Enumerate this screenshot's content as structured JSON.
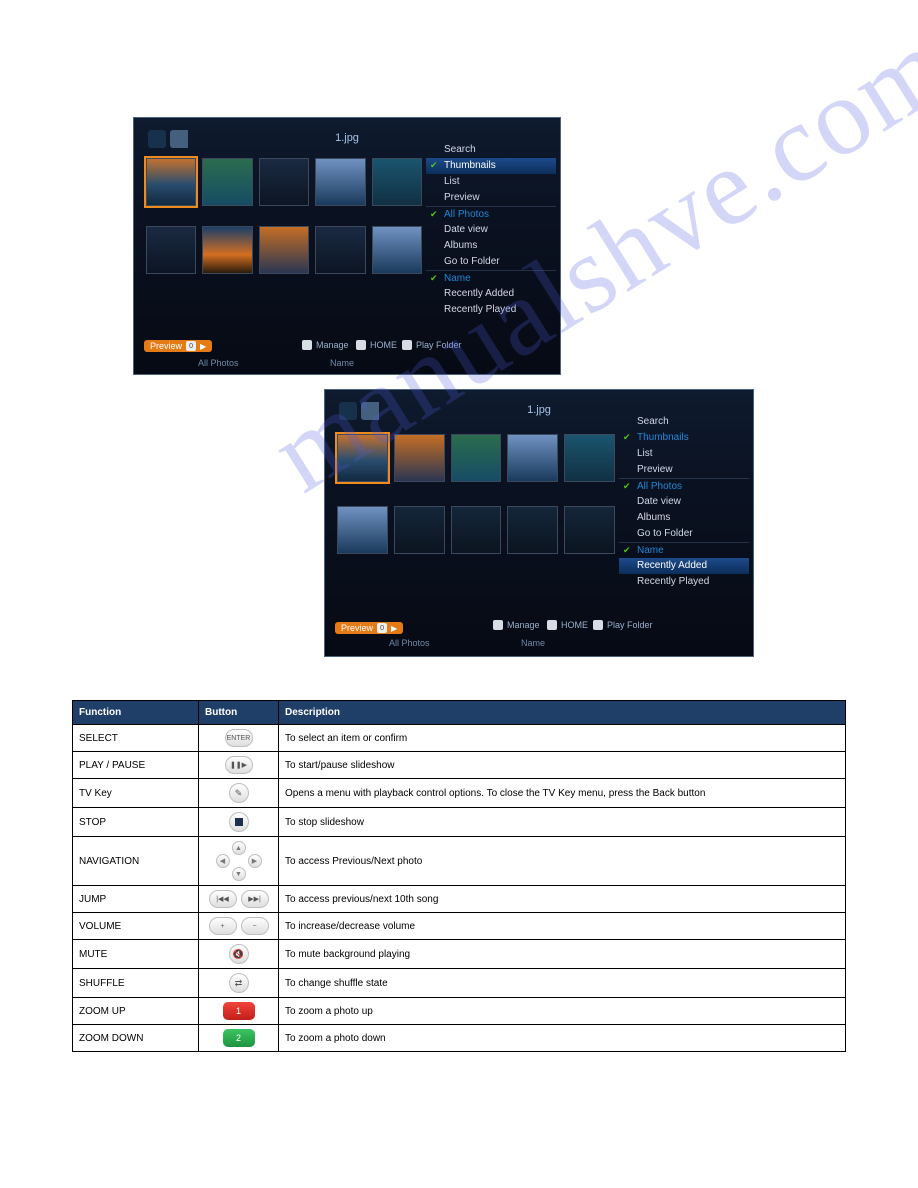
{
  "watermark_text": "manualshve.com",
  "screenshot1": {
    "title": "1.jpg",
    "menu_items": [
      {
        "label": "Search",
        "checked": false,
        "highlight": false,
        "active": false,
        "sep": false
      },
      {
        "label": "Thumbnails",
        "checked": true,
        "highlight": true,
        "active": false,
        "sep": false
      },
      {
        "label": "List",
        "checked": false,
        "highlight": false,
        "active": false,
        "sep": false
      },
      {
        "label": "Preview",
        "checked": false,
        "highlight": false,
        "active": false,
        "sep": false
      },
      {
        "label": "All Photos",
        "checked": true,
        "highlight": false,
        "active": true,
        "sep": true
      },
      {
        "label": "Date view",
        "checked": false,
        "highlight": false,
        "active": false,
        "sep": false
      },
      {
        "label": "Albums",
        "checked": false,
        "highlight": false,
        "active": false,
        "sep": false
      },
      {
        "label": "Go to Folder",
        "checked": false,
        "highlight": false,
        "active": false,
        "sep": false
      },
      {
        "label": "Name",
        "checked": true,
        "highlight": false,
        "active": true,
        "sep": true
      },
      {
        "label": "Recently Added",
        "checked": false,
        "highlight": false,
        "active": false,
        "sep": false
      },
      {
        "label": "Recently Played",
        "checked": false,
        "highlight": false,
        "active": false,
        "sep": false
      }
    ],
    "footer": {
      "preview": "Preview",
      "manage": "Manage",
      "home": "HOME",
      "play": "Play Folder",
      "status_left": "All Photos",
      "status_right": "Name"
    }
  },
  "screenshot2": {
    "title": "1.jpg",
    "menu_items": [
      {
        "label": "Search",
        "checked": false,
        "highlight": false,
        "active": false,
        "sep": false
      },
      {
        "label": "Thumbnails",
        "checked": true,
        "highlight": false,
        "active": true,
        "sep": false
      },
      {
        "label": "List",
        "checked": false,
        "highlight": false,
        "active": false,
        "sep": false
      },
      {
        "label": "Preview",
        "checked": false,
        "highlight": false,
        "active": false,
        "sep": false
      },
      {
        "label": "All Photos",
        "checked": true,
        "highlight": false,
        "active": true,
        "sep": true
      },
      {
        "label": "Date view",
        "checked": false,
        "highlight": false,
        "active": false,
        "sep": false
      },
      {
        "label": "Albums",
        "checked": false,
        "highlight": false,
        "active": false,
        "sep": false
      },
      {
        "label": "Go to Folder",
        "checked": false,
        "highlight": false,
        "active": false,
        "sep": false
      },
      {
        "label": "Name",
        "checked": true,
        "highlight": false,
        "active": true,
        "sep": true
      },
      {
        "label": "Recently Added",
        "checked": false,
        "highlight": true,
        "active": false,
        "sep": false
      },
      {
        "label": "Recently Played",
        "checked": false,
        "highlight": false,
        "active": false,
        "sep": false
      }
    ],
    "footer": {
      "preview": "Preview",
      "manage": "Manage",
      "home": "HOME",
      "play": "Play Folder",
      "status_left": "All Photos",
      "status_right": "Name"
    }
  },
  "table": {
    "headers": [
      "Function",
      "Button",
      "Description"
    ],
    "rows": [
      {
        "fn": "SELECT",
        "icon": "enter",
        "desc": "To select an item or confirm"
      },
      {
        "fn": "PLAY / PAUSE",
        "icon": "playpause",
        "desc": "To start/pause slideshow"
      },
      {
        "fn": "TV Key",
        "icon": "wand",
        "desc": "Opens a menu with playback control options. To close the TV Key menu, press the Back button"
      },
      {
        "fn": "STOP",
        "icon": "stop",
        "desc": "To stop slideshow"
      },
      {
        "fn": "NAVIGATION",
        "icon": "dpad",
        "desc": "To access Previous/Next photo"
      },
      {
        "fn": "JUMP",
        "icon": "prevnext",
        "desc": "To access previous/next 10th song"
      },
      {
        "fn": "VOLUME",
        "icon": "plusminus",
        "desc": "To increase/decrease volume"
      },
      {
        "fn": "MUTE",
        "icon": "mute",
        "desc": "To mute background playing"
      },
      {
        "fn": "SHUFFLE",
        "icon": "shuffle",
        "desc": "To change shuffle state"
      },
      {
        "fn": "ZOOM UP",
        "icon": "red1",
        "desc": "To zoom a photo up"
      },
      {
        "fn": "ZOOM DOWN",
        "icon": "green2",
        "desc": "To zoom a photo down"
      }
    ]
  }
}
